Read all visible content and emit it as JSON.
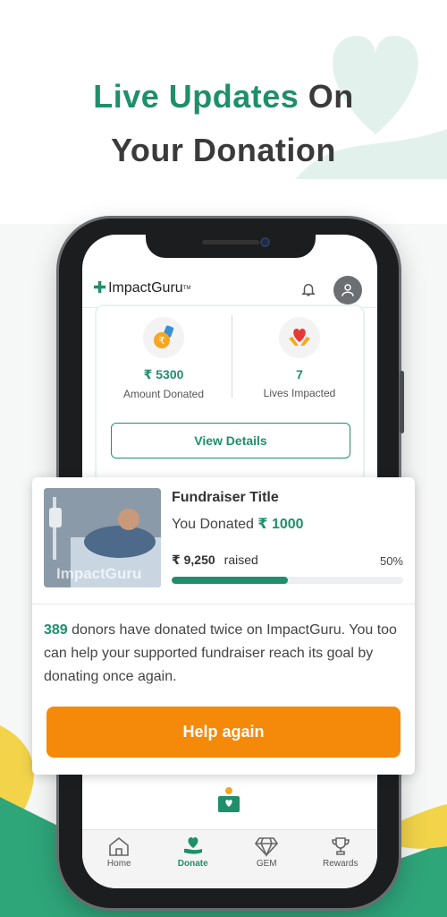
{
  "headline": {
    "accent": "Live Updates",
    "rest_line1": " On",
    "line2": "Your Donation"
  },
  "app": {
    "logo_text": "ImpactGuru",
    "stats": {
      "amount_value": "₹ 5300",
      "amount_label": "Amount Donated",
      "lives_value": "7",
      "lives_label": "Lives Impacted",
      "view_details": "View Details"
    },
    "bottom_nav": [
      {
        "label": "Home",
        "icon": "home-icon"
      },
      {
        "label": "Donate",
        "icon": "donate-heart-icon",
        "active": true
      },
      {
        "label": "GEM",
        "icon": "gem-icon"
      },
      {
        "label": "Rewards",
        "icon": "trophy-icon"
      }
    ]
  },
  "popup": {
    "thumbnail_watermark": "ImpactGuru",
    "title": "Fundraiser Title",
    "donated_prefix": "You Donated",
    "donated_amount": "₹ 1000",
    "raised_amount": "₹ 9,250",
    "raised_label": "raised",
    "percent_label": "50%",
    "progress": 0.5,
    "donor_count": "389",
    "appeal_text": " donors have donated twice on ImpactGuru. You too can help your supported fundraiser reach its goal by donating once again.",
    "help_button": "Help again"
  },
  "colors": {
    "brand_green": "#1f8f6b",
    "cta_orange": "#f58a0a",
    "banner_yellow": "#f2d34a"
  }
}
